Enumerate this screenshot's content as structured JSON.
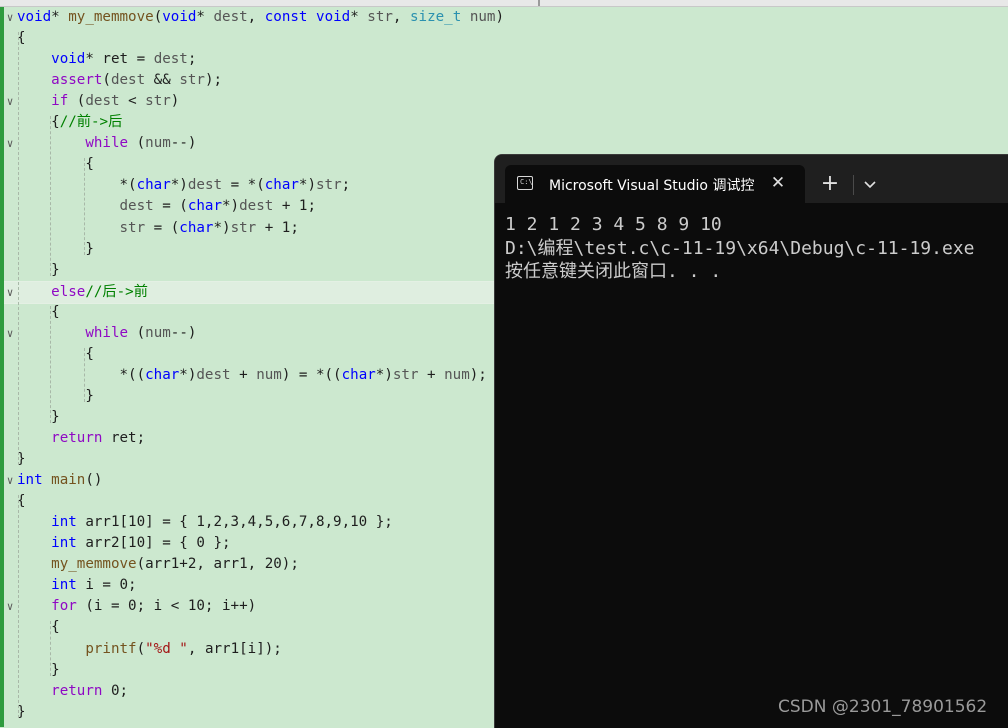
{
  "editor": {
    "lines": [
      [
        {
          "t": "void",
          "c": "kw"
        },
        {
          "t": "* "
        },
        {
          "t": "my_memmove",
          "c": "fn"
        },
        {
          "t": "("
        },
        {
          "t": "void",
          "c": "kw"
        },
        {
          "t": "* "
        },
        {
          "t": "dest",
          "c": "prm"
        },
        {
          "t": ", "
        },
        {
          "t": "const",
          "c": "kw"
        },
        {
          "t": " "
        },
        {
          "t": "void",
          "c": "kw"
        },
        {
          "t": "* "
        },
        {
          "t": "str",
          "c": "prm"
        },
        {
          "t": ", "
        },
        {
          "t": "size_t",
          "c": "ty"
        },
        {
          "t": " "
        },
        {
          "t": "num",
          "c": "prm"
        },
        {
          "t": ")"
        }
      ],
      [
        {
          "t": "{"
        }
      ],
      [
        {
          "t": "    "
        },
        {
          "t": "void",
          "c": "kw"
        },
        {
          "t": "* ret = "
        },
        {
          "t": "dest",
          "c": "prm"
        },
        {
          "t": ";"
        }
      ],
      [
        {
          "t": "    "
        },
        {
          "t": "assert",
          "c": "ctl"
        },
        {
          "t": "("
        },
        {
          "t": "dest",
          "c": "prm"
        },
        {
          "t": " && "
        },
        {
          "t": "str",
          "c": "prm"
        },
        {
          "t": ");"
        }
      ],
      [
        {
          "t": "    "
        },
        {
          "t": "if",
          "c": "ctl"
        },
        {
          "t": " ("
        },
        {
          "t": "dest",
          "c": "prm"
        },
        {
          "t": " < "
        },
        {
          "t": "str",
          "c": "prm"
        },
        {
          "t": ")"
        }
      ],
      [
        {
          "t": "    {"
        },
        {
          "t": "//前->后",
          "c": "cmt"
        }
      ],
      [
        {
          "t": "        "
        },
        {
          "t": "while",
          "c": "ctl"
        },
        {
          "t": " ("
        },
        {
          "t": "num",
          "c": "prm"
        },
        {
          "t": "--)"
        }
      ],
      [
        {
          "t": "        {"
        }
      ],
      [
        {
          "t": "            *("
        },
        {
          "t": "char",
          "c": "kw"
        },
        {
          "t": "*)"
        },
        {
          "t": "dest",
          "c": "prm"
        },
        {
          "t": " = *("
        },
        {
          "t": "char",
          "c": "kw"
        },
        {
          "t": "*)"
        },
        {
          "t": "str",
          "c": "prm"
        },
        {
          "t": ";"
        }
      ],
      [
        {
          "t": "            "
        },
        {
          "t": "dest",
          "c": "prm"
        },
        {
          "t": " = ("
        },
        {
          "t": "char",
          "c": "kw"
        },
        {
          "t": "*)"
        },
        {
          "t": "dest",
          "c": "prm"
        },
        {
          "t": " + 1;"
        }
      ],
      [
        {
          "t": "            "
        },
        {
          "t": "str",
          "c": "prm"
        },
        {
          "t": " = ("
        },
        {
          "t": "char",
          "c": "kw"
        },
        {
          "t": "*)"
        },
        {
          "t": "str",
          "c": "prm"
        },
        {
          "t": " + 1;"
        }
      ],
      [
        {
          "t": "        }"
        }
      ],
      [
        {
          "t": "    }"
        }
      ],
      [
        {
          "t": "    "
        },
        {
          "t": "else",
          "c": "ctl"
        },
        {
          "t": "//后->前",
          "c": "cmt"
        }
      ],
      [
        {
          "t": "    {"
        }
      ],
      [
        {
          "t": "        "
        },
        {
          "t": "while",
          "c": "ctl"
        },
        {
          "t": " ("
        },
        {
          "t": "num",
          "c": "prm"
        },
        {
          "t": "--)"
        }
      ],
      [
        {
          "t": "        {"
        }
      ],
      [
        {
          "t": "            *(("
        },
        {
          "t": "char",
          "c": "kw"
        },
        {
          "t": "*)"
        },
        {
          "t": "dest",
          "c": "prm"
        },
        {
          "t": " + "
        },
        {
          "t": "num",
          "c": "prm"
        },
        {
          "t": ") = *(("
        },
        {
          "t": "char",
          "c": "kw"
        },
        {
          "t": "*)"
        },
        {
          "t": "str",
          "c": "prm"
        },
        {
          "t": " + "
        },
        {
          "t": "num",
          "c": "prm"
        },
        {
          "t": ");"
        }
      ],
      [
        {
          "t": "        }"
        }
      ],
      [
        {
          "t": "    }"
        }
      ],
      [
        {
          "t": "    "
        },
        {
          "t": "return",
          "c": "ctl"
        },
        {
          "t": " ret;"
        }
      ],
      [
        {
          "t": "}"
        }
      ],
      [
        {
          "t": "int",
          "c": "kw"
        },
        {
          "t": " "
        },
        {
          "t": "main",
          "c": "fn"
        },
        {
          "t": "()"
        }
      ],
      [
        {
          "t": "{"
        }
      ],
      [
        {
          "t": "    "
        },
        {
          "t": "int",
          "c": "kw"
        },
        {
          "t": " arr1[10] = { 1,2,3,4,5,6,7,8,9,10 };"
        }
      ],
      [
        {
          "t": "    "
        },
        {
          "t": "int",
          "c": "kw"
        },
        {
          "t": " arr2[10] = { 0 };"
        }
      ],
      [
        {
          "t": "    "
        },
        {
          "t": "my_memmove",
          "c": "fn"
        },
        {
          "t": "(arr1+2, arr1, 20);"
        }
      ],
      [
        {
          "t": "    "
        },
        {
          "t": "int",
          "c": "kw"
        },
        {
          "t": " i = 0;"
        }
      ],
      [
        {
          "t": "    "
        },
        {
          "t": "for",
          "c": "ctl"
        },
        {
          "t": " (i = 0; i < 10; i++)"
        }
      ],
      [
        {
          "t": "    {"
        }
      ],
      [
        {
          "t": "        "
        },
        {
          "t": "printf",
          "c": "fn"
        },
        {
          "t": "("
        },
        {
          "t": "\"%d \"",
          "c": "str"
        },
        {
          "t": ", arr1[i]);"
        }
      ],
      [
        {
          "t": "    }"
        }
      ],
      [
        {
          "t": "    "
        },
        {
          "t": "return",
          "c": "ctl"
        },
        {
          "t": " 0;"
        }
      ],
      [
        {
          "t": "}"
        }
      ]
    ],
    "fold_markers": {
      "0": "∨",
      "4": "∨",
      "6": "∨",
      "13": "∨",
      "15": "∨",
      "22": "∨",
      "28": "∨"
    },
    "current_line_index": 13
  },
  "terminal": {
    "tab_title": "Microsoft Visual Studio 调试控制台",
    "tab_icon_text": "C:\\",
    "close_glyph": "✕",
    "new_tab_glyph": "+",
    "output": [
      "1 2 1 2 3 4 5 8 9 10",
      "D:\\编程\\test.c\\c-11-19\\x64\\Debug\\c-11-19.exe",
      "按任意键关闭此窗口. . ."
    ]
  },
  "watermark": "CSDN @2301_78901562"
}
